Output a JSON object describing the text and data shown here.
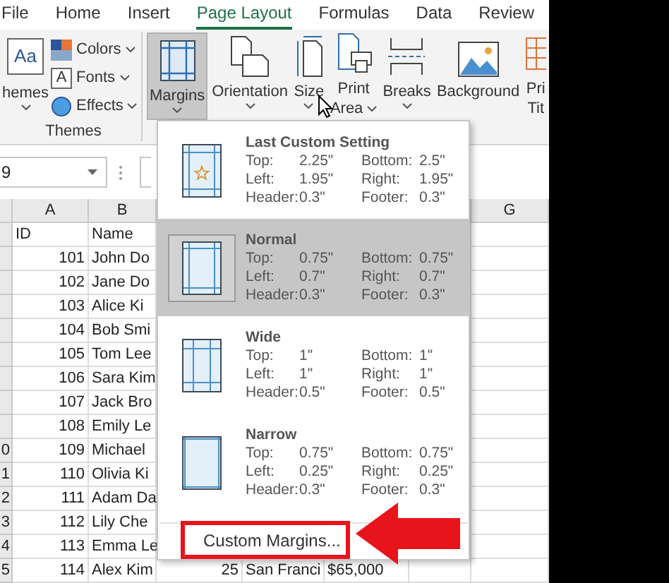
{
  "tabs": [
    {
      "label": "File",
      "selected": false
    },
    {
      "label": "Home",
      "selected": false
    },
    {
      "label": "Insert",
      "selected": false
    },
    {
      "label": "Page Layout",
      "selected": true
    },
    {
      "label": "Formulas",
      "selected": false
    },
    {
      "label": "Data",
      "selected": false
    },
    {
      "label": "Review",
      "selected": false
    }
  ],
  "ribbon": {
    "themes": {
      "icon_text": "Aa",
      "label": "hemes"
    },
    "theme_options": [
      {
        "kind": "colors",
        "label": "Colors"
      },
      {
        "kind": "fonts",
        "label": "Fonts",
        "icon_text": "A"
      },
      {
        "kind": "effects",
        "label": "Effects"
      }
    ],
    "group_label": "Themes",
    "buttons": [
      {
        "kind": "margins",
        "lines": [
          "Margins"
        ],
        "dropdown": true,
        "pressed": true
      },
      {
        "kind": "orientation",
        "lines": [
          "Orientation"
        ],
        "dropdown": true,
        "pressed": false
      },
      {
        "kind": "size",
        "lines": [
          "Size"
        ],
        "dropdown": true,
        "pressed": false
      },
      {
        "kind": "print_area",
        "lines": [
          "Print",
          "Area"
        ],
        "dropdown": true,
        "pressed": false
      },
      {
        "kind": "breaks",
        "lines": [
          "Breaks"
        ],
        "dropdown": true,
        "pressed": false
      },
      {
        "kind": "background",
        "lines": [
          "Background"
        ],
        "dropdown": false,
        "pressed": false
      },
      {
        "kind": "print_titles",
        "lines": [
          "Pri",
          "Tit"
        ],
        "dropdown": false,
        "pressed": false
      }
    ]
  },
  "name_box": {
    "value": "9"
  },
  "sheet": {
    "columns": [
      {
        "label": "A"
      },
      {
        "label": "B"
      },
      {
        "label": "G"
      }
    ],
    "rows": [
      {
        "kind": "header",
        "cells": [
          "ID",
          "Name"
        ]
      },
      {
        "kind": "data",
        "cells": [
          "101",
          "John Do"
        ]
      },
      {
        "kind": "data",
        "cells": [
          "102",
          "Jane Do"
        ]
      },
      {
        "kind": "data",
        "cells": [
          "103",
          "Alice Ki"
        ]
      },
      {
        "kind": "data",
        "cells": [
          "104",
          "Bob Smi"
        ]
      },
      {
        "kind": "data",
        "cells": [
          "105",
          "Tom Lee"
        ]
      },
      {
        "kind": "data",
        "cells": [
          "106",
          "Sara Kim"
        ]
      },
      {
        "kind": "data",
        "cells": [
          "107",
          "Jack Bro"
        ]
      },
      {
        "kind": "data",
        "cells": [
          "108",
          "Emily Le"
        ]
      },
      {
        "kind": "data",
        "header": "0",
        "cells": [
          "109",
          "Michael"
        ]
      },
      {
        "kind": "data",
        "header": "1",
        "cells": [
          "110",
          "Olivia Ki"
        ]
      },
      {
        "kind": "data",
        "header": "2",
        "cells": [
          "111",
          "Adam Da"
        ]
      },
      {
        "kind": "data",
        "header": "3",
        "cells": [
          "112",
          "Lily Che"
        ]
      },
      {
        "kind": "data",
        "header": "4",
        "cells": [
          "113",
          "Emma Le"
        ]
      },
      {
        "kind": "data",
        "header": "5",
        "cells": [
          "114",
          "Alex Kim",
          "25",
          "San Franci",
          "$65,000"
        ]
      }
    ]
  },
  "margins_menu": {
    "items": [
      {
        "kind": "custom",
        "name": "Last Custom Setting",
        "selected": false,
        "fields": [
          {
            "label": "Top:",
            "value": "2.25\""
          },
          {
            "label": "Bottom:",
            "value": "2.5\""
          },
          {
            "label": "Left:",
            "value": "1.95\""
          },
          {
            "label": "Right:",
            "value": "1.95\""
          },
          {
            "label": "Header:",
            "value": "0.3\""
          },
          {
            "label": "Footer:",
            "value": "0.3\""
          }
        ]
      },
      {
        "kind": "normal",
        "name": "Normal",
        "selected": true,
        "fields": [
          {
            "label": "Top:",
            "value": "0.75\""
          },
          {
            "label": "Bottom:",
            "value": "0.75\""
          },
          {
            "label": "Left:",
            "value": "0.7\""
          },
          {
            "label": "Right:",
            "value": "0.7\""
          },
          {
            "label": "Header:",
            "value": "0.3\""
          },
          {
            "label": "Footer:",
            "value": "0.3\""
          }
        ]
      },
      {
        "kind": "wide",
        "name": "Wide",
        "selected": false,
        "fields": [
          {
            "label": "Top:",
            "value": "1\""
          },
          {
            "label": "Bottom:",
            "value": "1\""
          },
          {
            "label": "Left:",
            "value": "1\""
          },
          {
            "label": "Right:",
            "value": "1\""
          },
          {
            "label": "Header:",
            "value": "0.5\""
          },
          {
            "label": "Footer:",
            "value": "0.5\""
          }
        ]
      },
      {
        "kind": "narrow",
        "name": "Narrow",
        "selected": false,
        "fields": [
          {
            "label": "Top:",
            "value": "0.75\""
          },
          {
            "label": "Bottom:",
            "value": "0.75\""
          },
          {
            "label": "Left:",
            "value": "0.25\""
          },
          {
            "label": "Right:",
            "value": "0.25\""
          },
          {
            "label": "Header:",
            "value": "0.3\""
          },
          {
            "label": "Footer:",
            "value": "0.3\""
          }
        ]
      }
    ],
    "footer": "Custom Margins..."
  }
}
